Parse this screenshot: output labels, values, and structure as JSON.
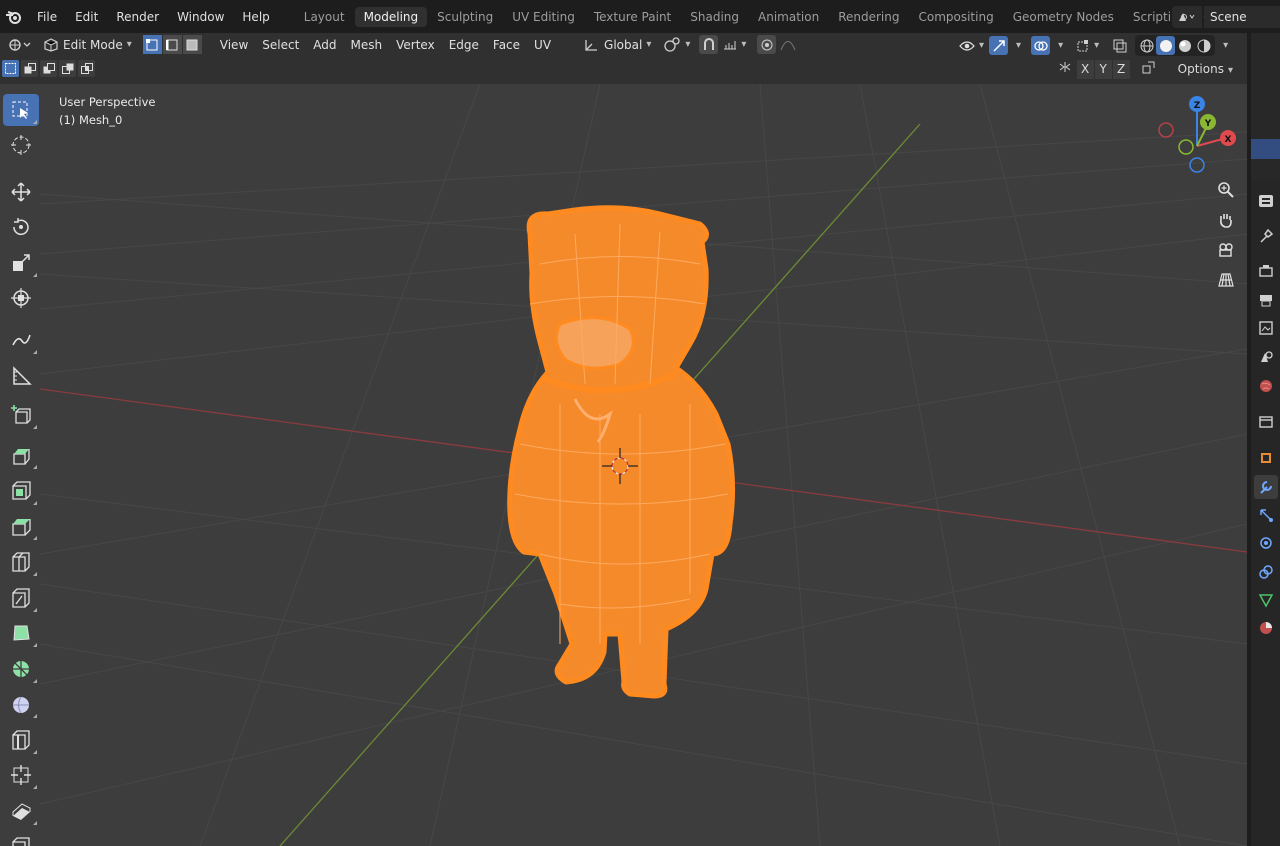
{
  "topbar": {
    "menus": [
      "File",
      "Edit",
      "Render",
      "Window",
      "Help"
    ],
    "workspaces": [
      "Layout",
      "Modeling",
      "Sculpting",
      "UV Editing",
      "Texture Paint",
      "Shading",
      "Animation",
      "Rendering",
      "Compositing",
      "Geometry Nodes",
      "Scripting"
    ],
    "active_workspace": "Modeling",
    "add_workspace": "+",
    "scene": "Scene"
  },
  "header": {
    "mode": "Edit Mode",
    "menus": [
      "View",
      "Select",
      "Add",
      "Mesh",
      "Vertex",
      "Edge",
      "Face",
      "UV"
    ],
    "transform_orientation": "Global"
  },
  "subheader": {
    "axes": [
      "X",
      "Y",
      "Z"
    ],
    "options": "Options"
  },
  "viewport": {
    "view_name": "User Perspective",
    "object_name": "(1) Mesh_0",
    "gizmo_labels": {
      "x": "X",
      "y": "Y",
      "z": "Z"
    },
    "colors": {
      "background": "#3d3d3d",
      "x_axis": "#b0454a",
      "y_axis": "#7a9a3a",
      "mesh": "#ff8a1f",
      "x_gizmo": "#e04a4f",
      "y_gizmo": "#8ab832",
      "z_gizmo": "#3a84e6"
    }
  },
  "toolbar": {
    "tools": [
      "select-box",
      "cursor",
      "move",
      "rotate",
      "scale",
      "transform",
      "annotate",
      "measure",
      "add-cube",
      "extrude-region",
      "inset-faces",
      "bevel",
      "loop-cut",
      "knife",
      "poly-build",
      "spin",
      "smooth",
      "edge-slide",
      "shrink-fatten",
      "shear",
      "rip-region"
    ]
  },
  "properties": {
    "tabs": [
      "tool",
      "render",
      "output",
      "view-layer",
      "scene",
      "world",
      "collection",
      "object",
      "modifiers",
      "particles",
      "physics",
      "constraints",
      "data",
      "material"
    ]
  }
}
